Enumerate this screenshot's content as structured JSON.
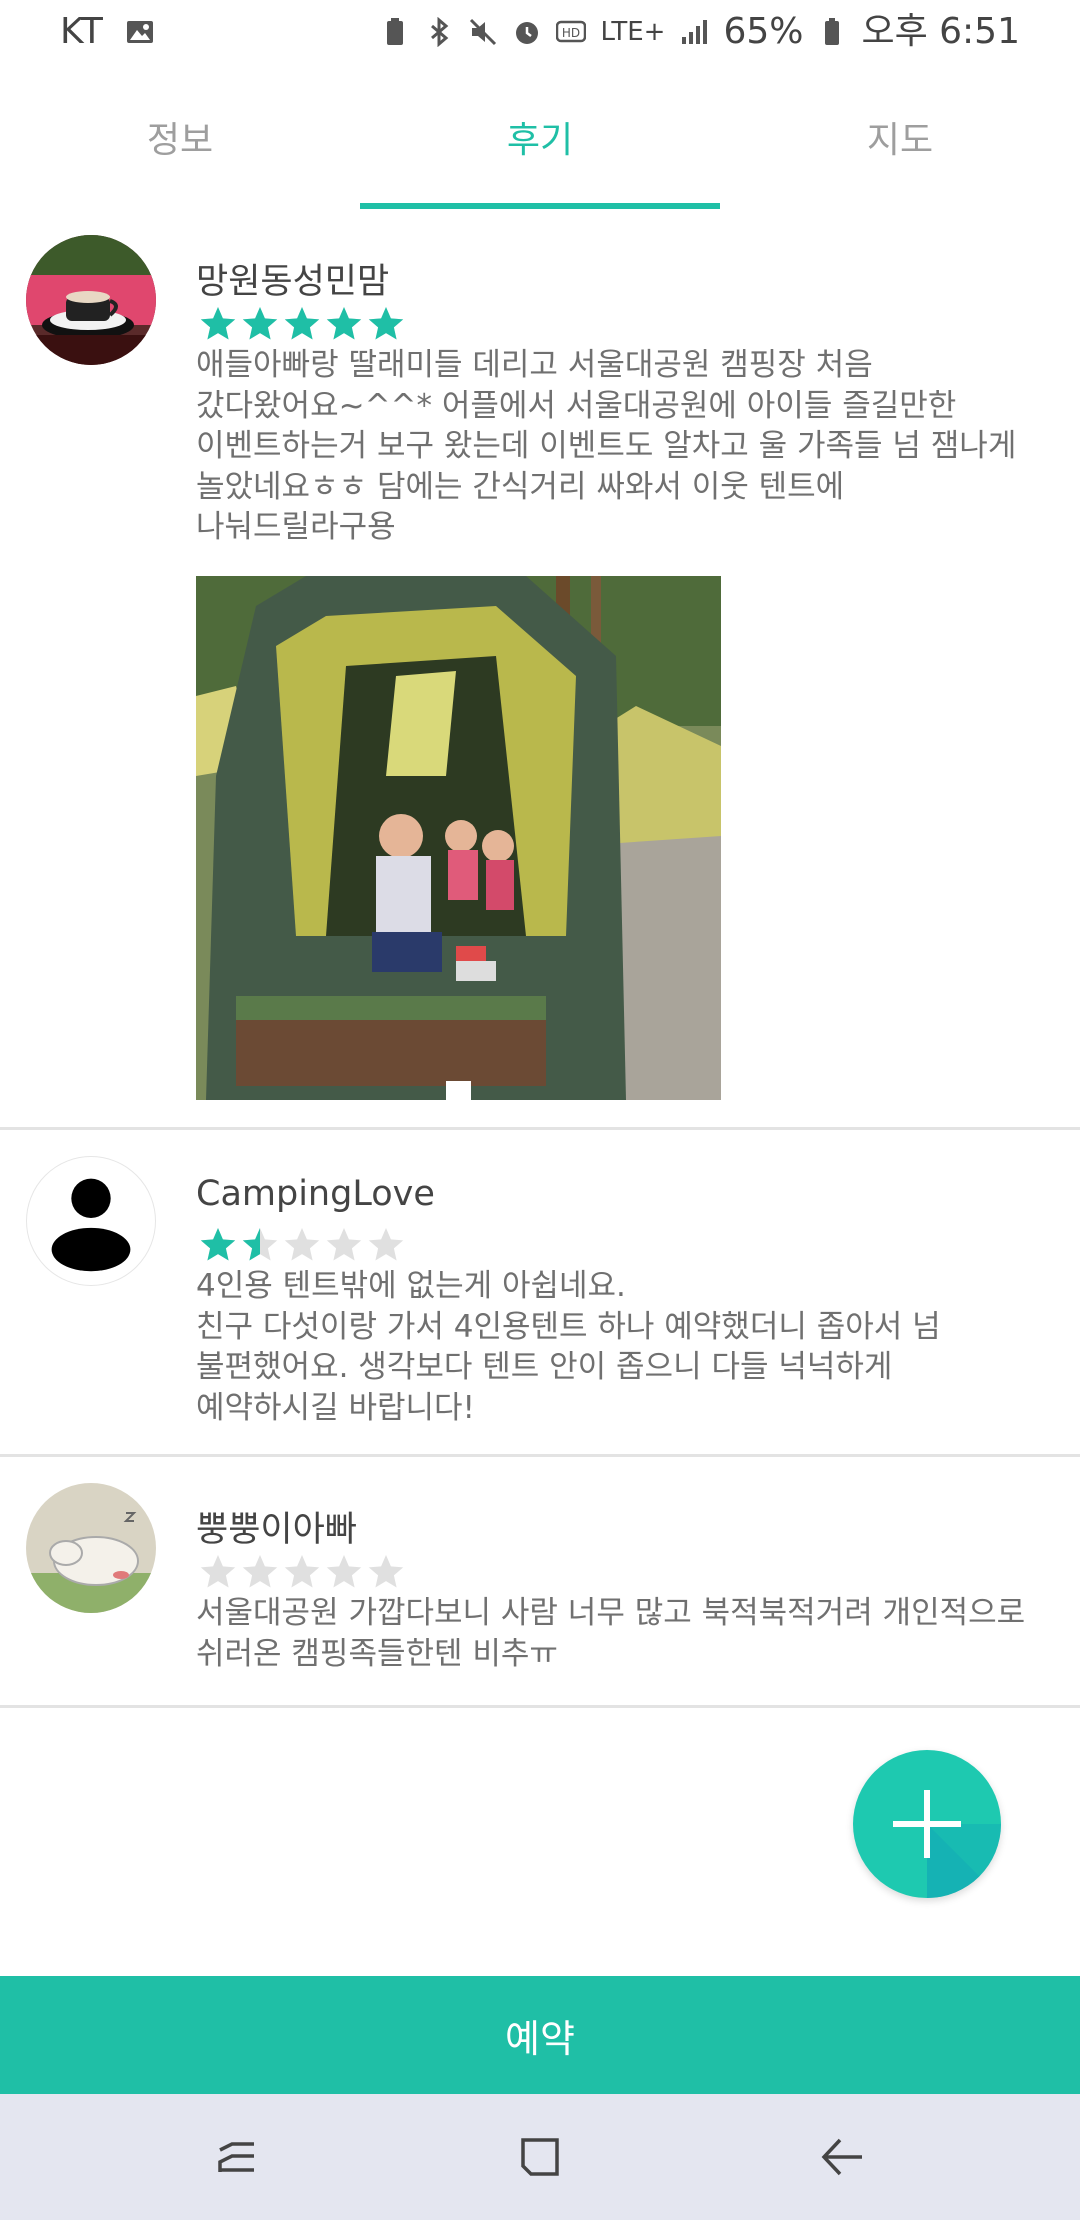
{
  "status_bar": {
    "carrier": "KT",
    "battery": "65%",
    "time": "오후 6:51",
    "network": "LTE+"
  },
  "tabs": [
    {
      "label": "정보",
      "active": false
    },
    {
      "label": "후기",
      "active": true
    },
    {
      "label": "지도",
      "active": false
    }
  ],
  "reviews": [
    {
      "name": "망원동성민맘",
      "rating": 5,
      "text": "애들아빠랑 딸래미들 데리고 서울대공원 캠핑장 처음\n갔다왔어요~^^*  어플에서 서울대공원에 아이들 즐길만한\n이벤트하는거 보구 왔는데 이벤트도 알차고 울 가족들 넘 잼나게\n놀았네요ㅎㅎ 담에는 간식거리 싸와서 이웃 텐트에\n나눠드릴라구용",
      "has_photo": true
    },
    {
      "name": "CampingLove",
      "rating": 1.5,
      "text": "4인용 텐트밖에 없는게 아쉽네요.\n친구 다섯이랑 가서 4인용텐트 하나 예약했더니 좁아서 넘\n불편했어요. 생각보다 텐트 안이 좁으니 다들 넉넉하게\n예약하시길 바랍니다!",
      "has_photo": false
    },
    {
      "name": "뿡뿡이아빠",
      "rating": 0,
      "text": "서울대공원 가깝다보니 사람 너무 많고 북적북적거려 개인적으로\n쉬러온 캠핑족들한텐 비추ㅠ",
      "has_photo": false
    }
  ],
  "fab": {
    "icon": "plus-icon"
  },
  "reserve_button": {
    "label": "예약"
  },
  "nav": [
    "recents-icon",
    "home-icon",
    "back-icon"
  ],
  "colors": {
    "accent": "#1fbfa6",
    "star_empty": "#e0e0e0"
  }
}
